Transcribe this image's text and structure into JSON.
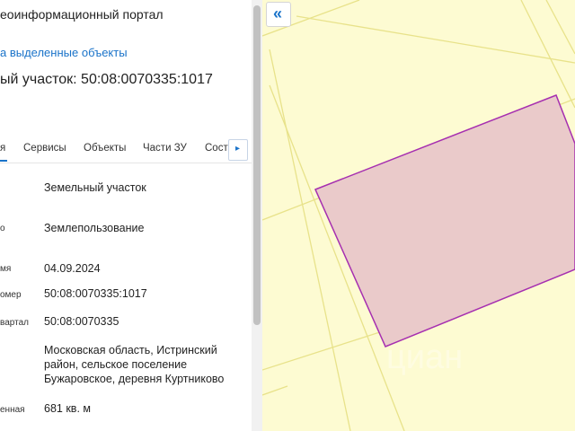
{
  "panel": {
    "title": "еоинформационный портал",
    "selected_link": "а выделенные объекты",
    "heading": "ый участок: 50:08:0070335:1017",
    "tabs": [
      {
        "label": "я"
      },
      {
        "label": "Сервисы"
      },
      {
        "label": "Объекты"
      },
      {
        "label": "Части ЗУ"
      },
      {
        "label": "Соста"
      }
    ],
    "tab_next_icon": "▸",
    "rows": [
      {
        "label": "",
        "value": "Земельный участок"
      },
      {
        "label": "о",
        "value": "Землепользование"
      },
      {
        "label": "мя",
        "value": "04.09.2024"
      },
      {
        "label": "омер",
        "value": "50:08:0070335:1017"
      },
      {
        "label": "вартал",
        "value": "50:08:0070335"
      },
      {
        "label": "",
        "value": "Московская область, Истринский район, сельское поселение Бужаровское, деревня Куртниково"
      },
      {
        "label": "енная",
        "value": "681 кв. м"
      }
    ]
  },
  "map": {
    "collapse_icon": "«",
    "watermark": "циан",
    "colors": {
      "background": "#fdfbd2",
      "lines": "#e8e28a",
      "parcel_fill": "#eacaca",
      "parcel_stroke": "#a62fb0"
    }
  }
}
